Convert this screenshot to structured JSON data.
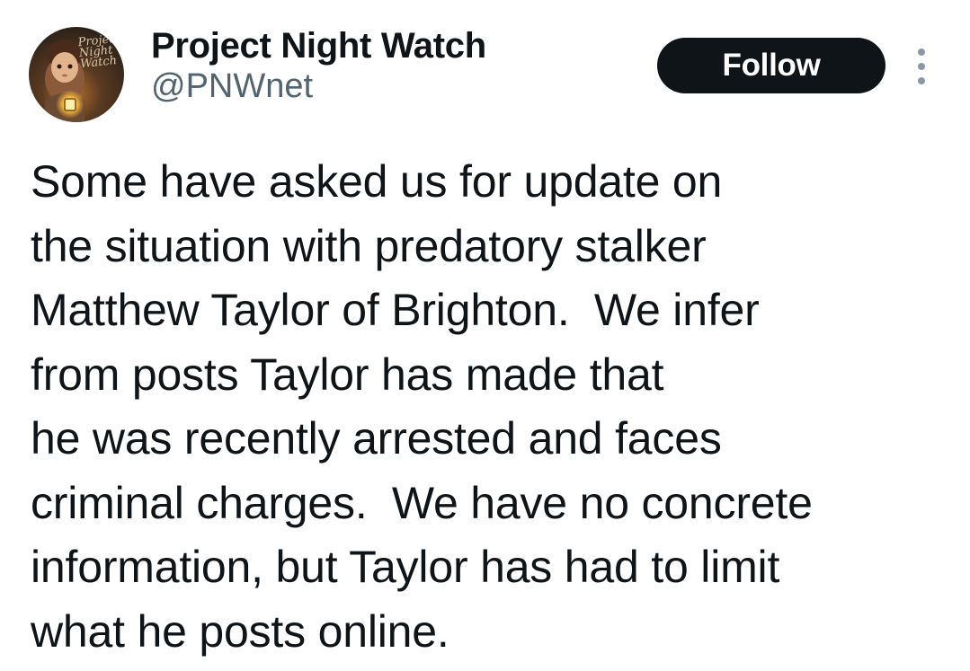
{
  "author": {
    "display_name": "Project Night Watch",
    "handle": "@PNWnet",
    "avatar_logo_text": [
      "Project",
      "Night",
      "Watch"
    ]
  },
  "follow_button": {
    "label": "Follow"
  },
  "more_menu": {
    "icon": "more-vertical-icon"
  },
  "tweet": {
    "lines": [
      "Some have asked us for update on",
      "the situation with predatory stalker",
      "Matthew Taylor of Brighton.  We infer",
      "from posts Taylor has made that",
      "he was recently arrested and faces",
      "criminal charges.  We have no concrete",
      "information, but Taylor has had to limit",
      "what he posts online."
    ]
  },
  "colors": {
    "text": "#0f1419",
    "secondary_text": "#536471",
    "follow_bg": "#0f1419",
    "follow_text": "#ffffff",
    "more_dots": "#8b98a5"
  }
}
